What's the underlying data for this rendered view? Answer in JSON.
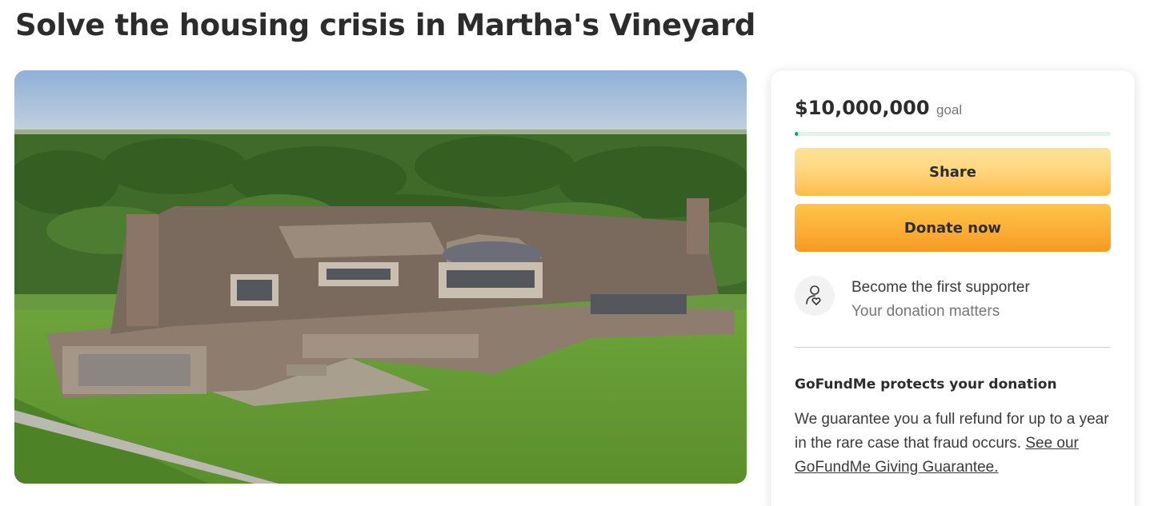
{
  "page": {
    "title": "Solve the housing crisis in Martha's Vineyard"
  },
  "hero": {
    "image_description_icon": "house-photo"
  },
  "donation": {
    "goal_amount": "$10,000,000",
    "goal_word": "goal",
    "progress_fraction": 0.01,
    "progress_color": "#02a95c",
    "share_label": "Share",
    "donate_label": "Donate now",
    "supporter_icon": "heart-person-icon",
    "supporter_title": "Become the first supporter",
    "supporter_subtitle": "Your donation matters"
  },
  "protection": {
    "title": "GoFundMe protects your donation",
    "text": "We guarantee you a full refund for up to a year in the rare case that fraud occurs.",
    "link_text": "See our GoFundMe Giving Guarantee."
  }
}
